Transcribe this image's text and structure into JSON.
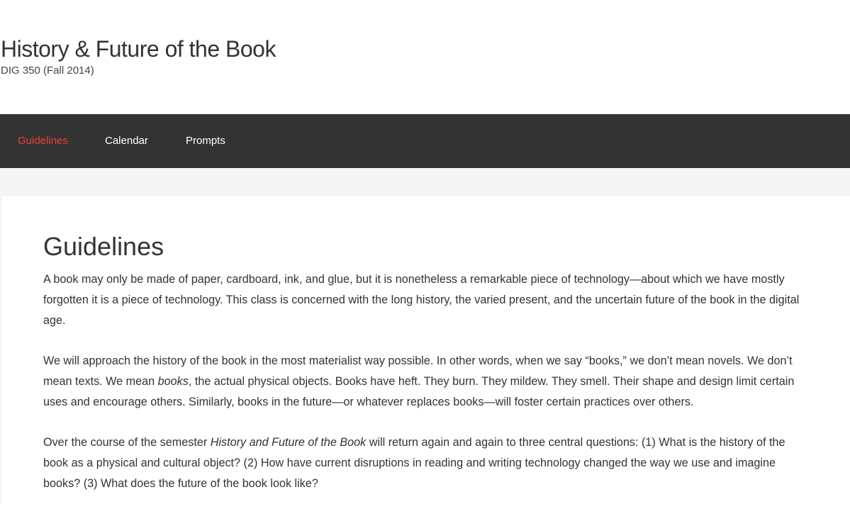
{
  "site": {
    "title": "History & Future of the Book",
    "tagline": "DIG 350 (Fall 2014)"
  },
  "nav": {
    "items": [
      {
        "label": "Guidelines",
        "active": true
      },
      {
        "label": "Calendar",
        "active": false
      },
      {
        "label": "Prompts",
        "active": false
      }
    ]
  },
  "colors": {
    "nav_background": "#333333",
    "nav_active": "#e9413b",
    "page_background": "#f5f5f5"
  },
  "page": {
    "title": "Guidelines",
    "p1": "A book may only be made of paper, cardboard, ink, and glue, but it is nonetheless a remarkable piece of technology—about which we have mostly forgotten it is a piece of technology. This class is concerned with the long history, the varied present, and the uncertain future of the book in the digital age.",
    "p2_a": "We will approach the history of the book in the most materialist way possible. In other words, when we say “books,” we don’t mean novels. We don’t mean texts. We mean ",
    "p2_em": "books",
    "p2_b": ", the actual physical objects. Books have heft. They burn. They mildew. They smell. Their shape and design limit certain uses and encourage others. Similarly, books in the future—or whatever replaces books—will foster certain practices over others.",
    "p3_a": "Over the course of the semester ",
    "p3_em": "History and Future of the Book",
    "p3_b": " will return again and again to three central questions: (1) What is the history of the book as a physical and cultural object? (2) How have current disruptions in reading and writing technology changed the way we use and imagine books? (3) What does the future of the book look like?"
  }
}
